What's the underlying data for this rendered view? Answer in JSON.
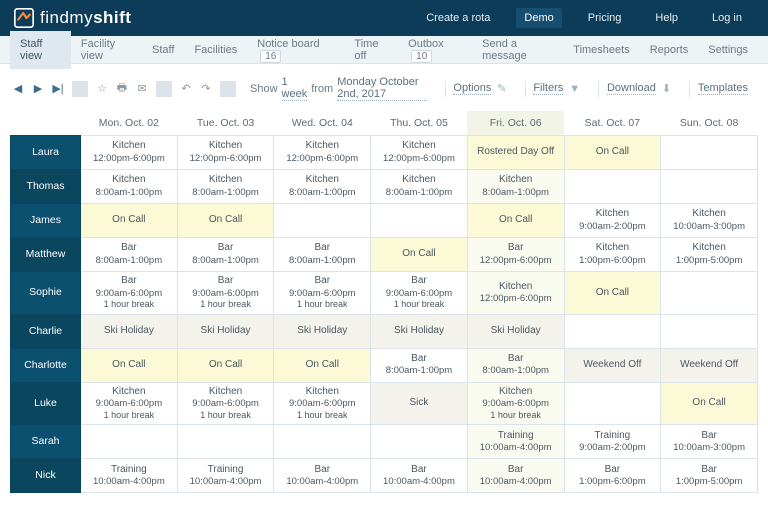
{
  "brand": {
    "name_a": "findmy",
    "name_b": "shift"
  },
  "topnav": {
    "create": "Create a rota",
    "demo": "Demo",
    "pricing": "Pricing",
    "help": "Help",
    "login": "Log in"
  },
  "subnav": {
    "staff_view": "Staff view",
    "facility_view": "Facility view",
    "staff": "Staff",
    "facilities": "Facilities",
    "notice_board": "Notice board",
    "notice_badge": "16",
    "time_off": "Time off",
    "outbox": "Outbox",
    "outbox_badge": "10",
    "send_msg": "Send a message",
    "timesheets": "Timesheets",
    "reports": "Reports",
    "settings": "Settings"
  },
  "toolbar": {
    "show": "Show",
    "span": "1 week",
    "from": "from",
    "date": "Monday October 2nd, 2017",
    "options": "Options",
    "filters": "Filters",
    "download": "Download",
    "templates": "Templates"
  },
  "columns": [
    "Mon. Oct. 02",
    "Tue. Oct. 03",
    "Wed. Oct. 04",
    "Thu. Oct. 05",
    "Fri. Oct. 06",
    "Sat. Oct. 07",
    "Sun. Oct. 08"
  ],
  "today_index": 4,
  "staff": [
    {
      "name": "Laura",
      "cells": [
        {
          "role": "Kitchen",
          "time": "12:00pm-6:00pm"
        },
        {
          "role": "Kitchen",
          "time": "12:00pm-6:00pm"
        },
        {
          "role": "Kitchen",
          "time": "12:00pm-6:00pm"
        },
        {
          "role": "Kitchen",
          "time": "12:00pm-6:00pm"
        },
        {
          "role": "Rostered Day Off",
          "hl": true
        },
        {
          "role": "On Call",
          "hl": true
        },
        {}
      ]
    },
    {
      "name": "Thomas",
      "cells": [
        {
          "role": "Kitchen",
          "time": "8:00am-1:00pm"
        },
        {
          "role": "Kitchen",
          "time": "8:00am-1:00pm"
        },
        {
          "role": "Kitchen",
          "time": "8:00am-1:00pm"
        },
        {
          "role": "Kitchen",
          "time": "8:00am-1:00pm"
        },
        {
          "role": "Kitchen",
          "time": "8:00am-1:00pm"
        },
        {},
        {}
      ]
    },
    {
      "name": "James",
      "cells": [
        {
          "role": "On Call",
          "hl": true
        },
        {
          "role": "On Call",
          "hl": true
        },
        {},
        {},
        {
          "role": "On Call",
          "hl": true
        },
        {
          "role": "Kitchen",
          "time": "9:00am-2:00pm"
        },
        {
          "role": "Kitchen",
          "time": "10:00am-3:00pm"
        }
      ]
    },
    {
      "name": "Matthew",
      "cells": [
        {
          "role": "Bar",
          "time": "8:00am-1:00pm"
        },
        {
          "role": "Bar",
          "time": "8:00am-1:00pm"
        },
        {
          "role": "Bar",
          "time": "8:00am-1:00pm"
        },
        {
          "role": "On Call",
          "hl": true
        },
        {
          "role": "Bar",
          "time": "12:00pm-6:00pm"
        },
        {
          "role": "Kitchen",
          "time": "1:00pm-6:00pm"
        },
        {
          "role": "Kitchen",
          "time": "1:00pm-5:00pm"
        }
      ]
    },
    {
      "name": "Sophie",
      "cells": [
        {
          "role": "Bar",
          "time": "9:00am-6:00pm",
          "note": "1 hour break"
        },
        {
          "role": "Bar",
          "time": "9:00am-6:00pm",
          "note": "1 hour break"
        },
        {
          "role": "Bar",
          "time": "9:00am-6:00pm",
          "note": "1 hour break"
        },
        {
          "role": "Bar",
          "time": "9:00am-6:00pm",
          "note": "1 hour break"
        },
        {
          "role": "Kitchen",
          "time": "12:00pm-6:00pm"
        },
        {
          "role": "On Call",
          "hl": true
        },
        {}
      ]
    },
    {
      "name": "Charlie",
      "cells": [
        {
          "role": "Ski Holiday",
          "soft": true
        },
        {
          "role": "Ski Holiday",
          "soft": true
        },
        {
          "role": "Ski Holiday",
          "soft": true
        },
        {
          "role": "Ski Holiday",
          "soft": true
        },
        {
          "role": "Ski Holiday",
          "soft": true
        },
        {},
        {}
      ]
    },
    {
      "name": "Charlotte",
      "cells": [
        {
          "role": "On Call",
          "hl": true
        },
        {
          "role": "On Call",
          "hl": true
        },
        {
          "role": "On Call",
          "hl": true
        },
        {
          "role": "Bar",
          "time": "8:00am-1:00pm"
        },
        {
          "role": "Bar",
          "time": "8:00am-1:00pm"
        },
        {
          "role": "Weekend Off",
          "soft": true
        },
        {
          "role": "Weekend Off",
          "soft": true
        }
      ]
    },
    {
      "name": "Luke",
      "cells": [
        {
          "role": "Kitchen",
          "time": "9:00am-6:00pm",
          "note": "1 hour break"
        },
        {
          "role": "Kitchen",
          "time": "9:00am-6:00pm",
          "note": "1 hour break"
        },
        {
          "role": "Kitchen",
          "time": "9:00am-6:00pm",
          "note": "1 hour break"
        },
        {
          "role": "Sick",
          "soft": true
        },
        {
          "role": "Kitchen",
          "time": "9:00am-6:00pm",
          "note": "1 hour break"
        },
        {},
        {
          "role": "On Call",
          "hl": true
        }
      ]
    },
    {
      "name": "Sarah",
      "cells": [
        {},
        {},
        {},
        {},
        {
          "role": "Training",
          "time": "10:00am-4:00pm"
        },
        {
          "role": "Training",
          "time": "9:00am-2:00pm"
        },
        {
          "role": "Bar",
          "time": "10:00am-3:00pm"
        }
      ]
    },
    {
      "name": "Nick",
      "cells": [
        {
          "role": "Training",
          "time": "10:00am-4:00pm"
        },
        {
          "role": "Training",
          "time": "10:00am-4:00pm"
        },
        {
          "role": "Bar",
          "time": "10:00am-4:00pm"
        },
        {
          "role": "Bar",
          "time": "10:00am-4:00pm"
        },
        {
          "role": "Bar",
          "time": "10:00am-4:00pm"
        },
        {
          "role": "Bar",
          "time": "1:00pm-6:00pm"
        },
        {
          "role": "Bar",
          "time": "1:00pm-5:00pm"
        }
      ]
    }
  ]
}
